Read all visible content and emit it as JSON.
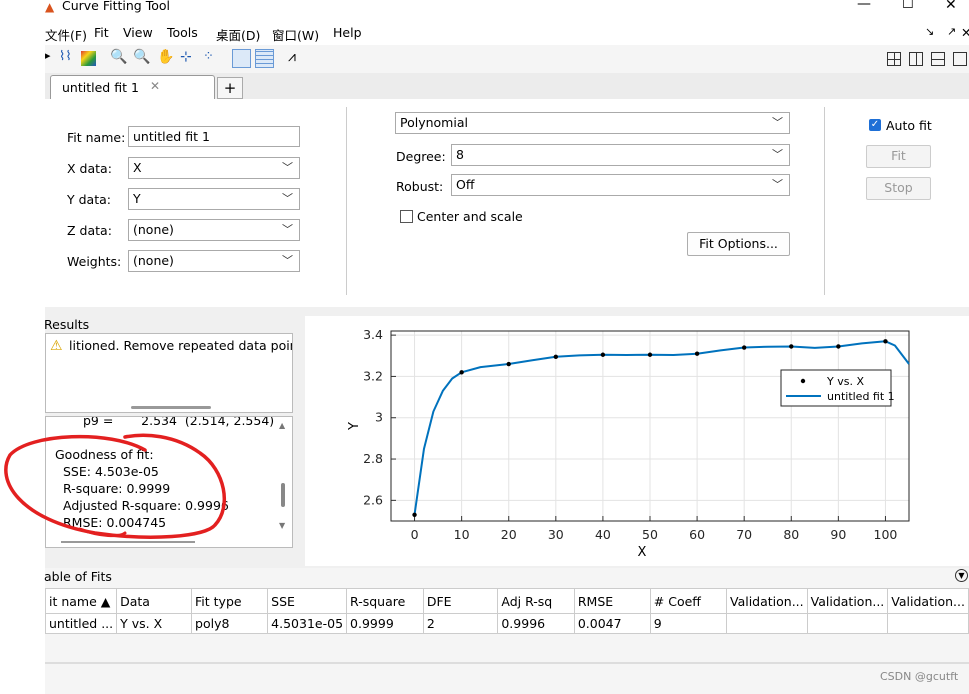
{
  "window": {
    "title": "Curve Fitting Tool"
  },
  "menu": [
    "文件(F)",
    "Fit",
    "View",
    "Tools",
    "桌面(D)",
    "窗口(W)",
    "Help"
  ],
  "tabs": {
    "active": "untitled fit 1",
    "add": "+"
  },
  "fit_form": {
    "fit_name_label": "Fit name:",
    "fit_name": "untitled fit 1",
    "x_label": "X data:",
    "x_value": "X",
    "y_label": "Y data:",
    "y_value": "Y",
    "z_label": "Z data:",
    "z_value": "(none)",
    "w_label": "Weights:",
    "w_value": "(none)"
  },
  "fit_type": {
    "type": "Polynomial",
    "degree_label": "Degree:",
    "degree": "8",
    "robust_label": "Robust:",
    "robust": "Off",
    "center_scale": "Center and scale",
    "options_button": "Fit Options..."
  },
  "actions": {
    "auto_fit": "Auto fit",
    "fit": "Fit",
    "stop": "Stop"
  },
  "results": {
    "title": "Results",
    "warning": "litioned. Remove repeated data points",
    "coef_line": "p9 =       2.534  (2.514, 2.554)",
    "gof_title": "Goodness of fit:",
    "sse": "SSE: 4.503e-05",
    "rsq": "R-square: 0.9999",
    "adjrsq": "Adjusted R-square: 0.9996",
    "rmse": "RMSE: 0.004745"
  },
  "chart_data": {
    "type": "line",
    "xlabel": "X",
    "ylabel": "Y",
    "xlim": [
      -5,
      105
    ],
    "ylim": [
      2.5,
      3.42
    ],
    "xticks": [
      0,
      10,
      20,
      30,
      40,
      50,
      60,
      70,
      80,
      90,
      100
    ],
    "yticks": [
      2.6,
      2.8,
      3,
      3.2,
      3.4
    ],
    "series": [
      {
        "name": "Y vs. X",
        "kind": "points",
        "x": [
          0,
          10,
          20,
          30,
          40,
          50,
          60,
          70,
          80,
          90,
          100
        ],
        "y": [
          2.53,
          3.22,
          3.26,
          3.295,
          3.305,
          3.305,
          3.31,
          3.34,
          3.345,
          3.345,
          3.37
        ]
      },
      {
        "name": "untitled fit 1",
        "kind": "line",
        "x": [
          0,
          2,
          4,
          6,
          8,
          10,
          14,
          20,
          25,
          30,
          35,
          40,
          45,
          50,
          55,
          60,
          65,
          70,
          75,
          80,
          85,
          90,
          95,
          100,
          102,
          105
        ],
        "y": [
          2.53,
          2.85,
          3.03,
          3.13,
          3.19,
          3.22,
          3.245,
          3.26,
          3.278,
          3.295,
          3.302,
          3.305,
          3.304,
          3.305,
          3.304,
          3.31,
          3.326,
          3.34,
          3.344,
          3.345,
          3.338,
          3.345,
          3.36,
          3.37,
          3.35,
          3.26
        ]
      }
    ],
    "legend": "top-right",
    "line_color": "#0072bd"
  },
  "table": {
    "title": "able of Fits",
    "headers": [
      "it name ▲",
      "Data",
      "Fit type",
      "SSE",
      "R-square",
      "DFE",
      "Adj R-sq",
      "RMSE",
      "# Coeff",
      "Validation...",
      "Validation...",
      "Validation..."
    ],
    "rows": [
      [
        "untitled ...",
        "Y vs. X",
        "poly8",
        "4.5031e-05",
        "0.9999",
        "2",
        "0.9996",
        "0.0047",
        "9",
        "",
        "",
        ""
      ]
    ]
  },
  "watermark": "CSDN @gcutft"
}
